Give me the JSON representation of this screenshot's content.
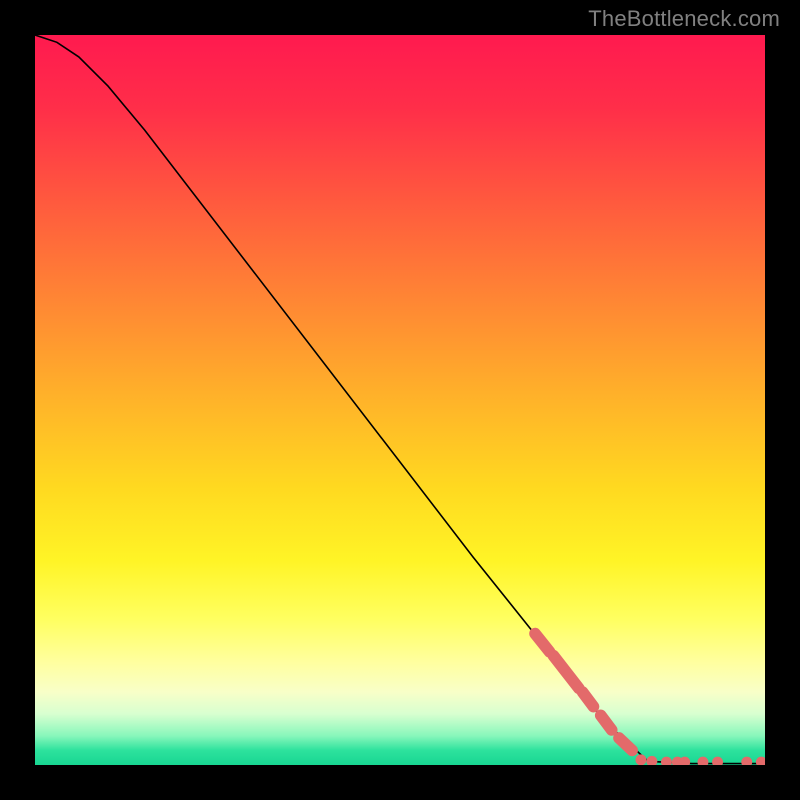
{
  "watermark": "TheBottleneck.com",
  "chart_data": {
    "type": "line",
    "title": "",
    "xlabel": "",
    "ylabel": "",
    "xlim": [
      0,
      100
    ],
    "ylim": [
      0,
      100
    ],
    "grid": false,
    "legend": false,
    "curve": [
      {
        "x": 0,
        "y": 100
      },
      {
        "x": 3,
        "y": 99
      },
      {
        "x": 6,
        "y": 97
      },
      {
        "x": 10,
        "y": 93
      },
      {
        "x": 15,
        "y": 87
      },
      {
        "x": 20,
        "y": 80.5
      },
      {
        "x": 30,
        "y": 67.5
      },
      {
        "x": 40,
        "y": 54.5
      },
      {
        "x": 50,
        "y": 41.5
      },
      {
        "x": 60,
        "y": 28.5
      },
      {
        "x": 70,
        "y": 16
      },
      {
        "x": 78,
        "y": 6
      },
      {
        "x": 84,
        "y": 0.5
      },
      {
        "x": 90,
        "y": 0.2
      },
      {
        "x": 100,
        "y": 0.2
      }
    ],
    "marker_segments": [
      {
        "x1": 68.5,
        "y1": 18.0,
        "x2": 70.5,
        "y2": 15.5
      },
      {
        "x1": 71.0,
        "y1": 15.0,
        "x2": 74.5,
        "y2": 10.5
      },
      {
        "x1": 75.0,
        "y1": 10.0,
        "x2": 76.5,
        "y2": 8.0
      },
      {
        "x1": 77.5,
        "y1": 6.8,
        "x2": 79.0,
        "y2": 4.8
      },
      {
        "x1": 80.0,
        "y1": 3.7,
        "x2": 81.8,
        "y2": 2.0
      }
    ],
    "marker_dots_flat": [
      {
        "x": 83.0,
        "y": 0.7
      },
      {
        "x": 84.5,
        "y": 0.5
      },
      {
        "x": 86.5,
        "y": 0.4
      },
      {
        "x": 88.0,
        "y": 0.4
      },
      {
        "x": 89.0,
        "y": 0.4
      },
      {
        "x": 91.5,
        "y": 0.4
      },
      {
        "x": 93.5,
        "y": 0.4
      },
      {
        "x": 97.5,
        "y": 0.4
      },
      {
        "x": 99.5,
        "y": 0.4
      }
    ],
    "marker_color": "#e36a6a",
    "line_color": "#000000"
  }
}
